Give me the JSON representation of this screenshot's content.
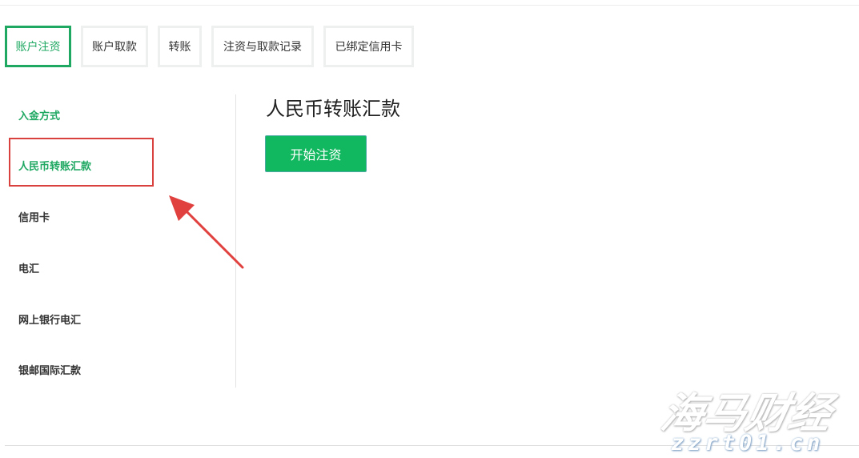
{
  "tabs": [
    {
      "label": "账户注资",
      "active": true
    },
    {
      "label": "账户取款",
      "active": false
    },
    {
      "label": "转账",
      "active": false
    },
    {
      "label": "注资与取款记录",
      "active": false
    },
    {
      "label": "已绑定信用卡",
      "active": false
    }
  ],
  "sidebar": {
    "items": [
      {
        "label": "入金方式"
      },
      {
        "label": "人民币转账汇款"
      },
      {
        "label": "信用卡"
      },
      {
        "label": "电汇"
      },
      {
        "label": "网上银行电汇"
      },
      {
        "label": "银邮国际汇款"
      }
    ]
  },
  "content": {
    "title": "人民币转账汇款",
    "start_button_label": "开始注资"
  },
  "watermark": {
    "brand": "海马财经",
    "url": "zzrt01.cn"
  },
  "colors": {
    "accent_green": "#1fa862",
    "button_green": "#12b85f",
    "highlight_red": "#d9413f"
  },
  "icons": {
    "annotation_arrow": "arrow-annotation-icon"
  }
}
